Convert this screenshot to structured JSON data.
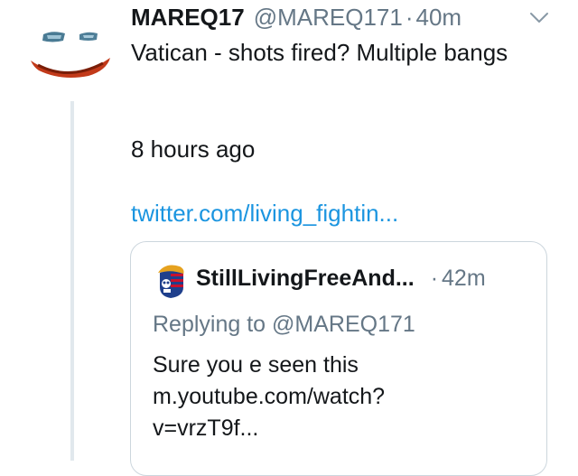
{
  "tweet": {
    "author_name": "MAREQ17",
    "handle": "@MAREQ171",
    "separator": "·",
    "time": "40m",
    "menu_icon": "chevron-down-icon",
    "text": "Vatican - shots fired? Multiple bangs",
    "subtext": "8 hours ago",
    "link_text": "twitter.com/living_fightin..."
  },
  "quoted": {
    "author_name": "StillLivingFreeAnd...",
    "separator": "·",
    "time": "42m",
    "replying_to": "Replying to @MAREQ171",
    "text_lines": [
      "Sure you e seen this",
      "m.youtube.com/watch?",
      "v=vrzT9f..."
    ]
  },
  "colors": {
    "text": "#14171a",
    "muted": "#657786",
    "link": "#1b95e0",
    "border": "#ccd6dd",
    "thread_line": "#e1e8ed"
  }
}
